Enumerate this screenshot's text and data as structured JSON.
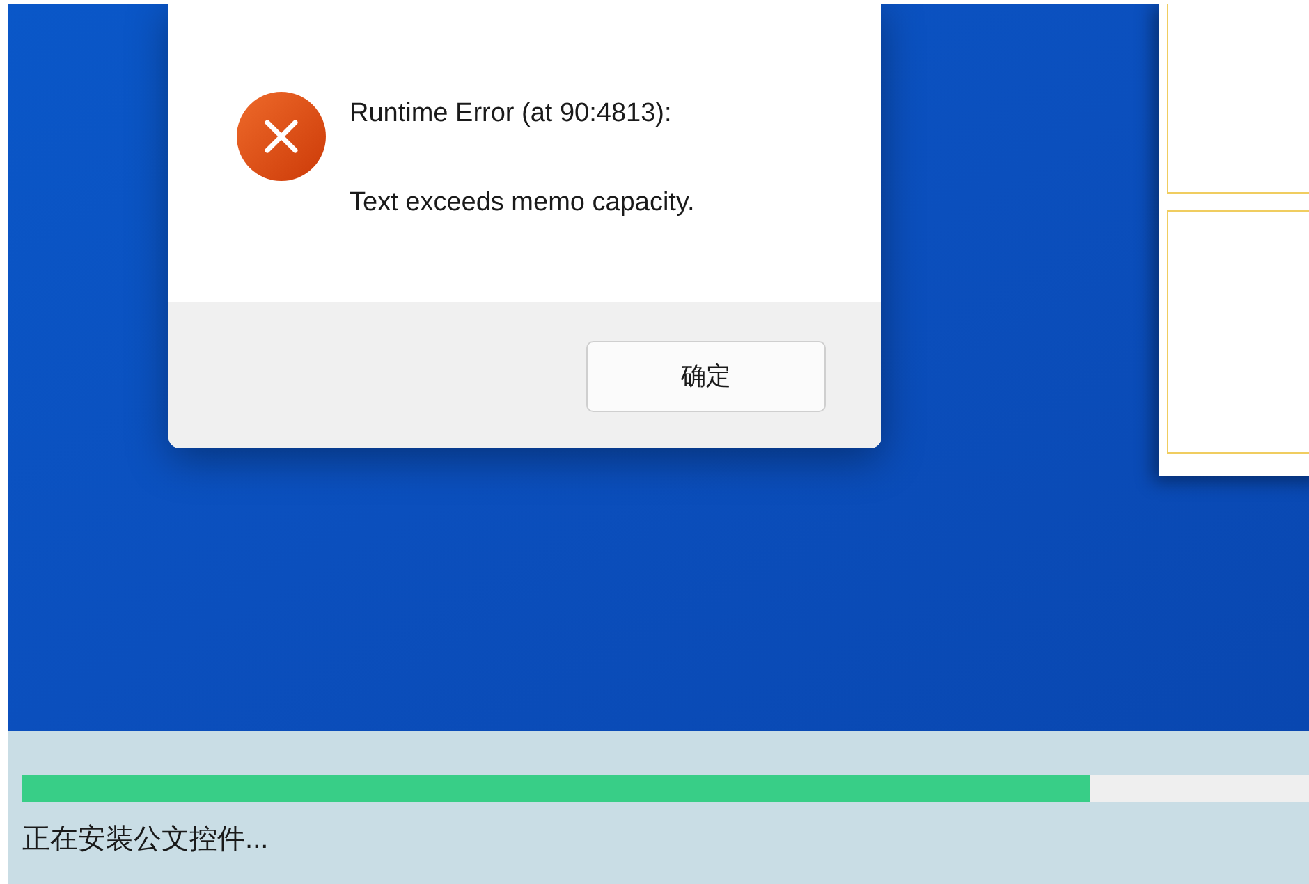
{
  "dialog": {
    "heading": "Runtime Error (at 90:4813):",
    "message": "Text exceeds memo capacity.",
    "buttons": [
      "确定"
    ]
  },
  "installer": {
    "progress": {
      "level": 0.83
    },
    "status": "正在安装公文控件..."
  }
}
